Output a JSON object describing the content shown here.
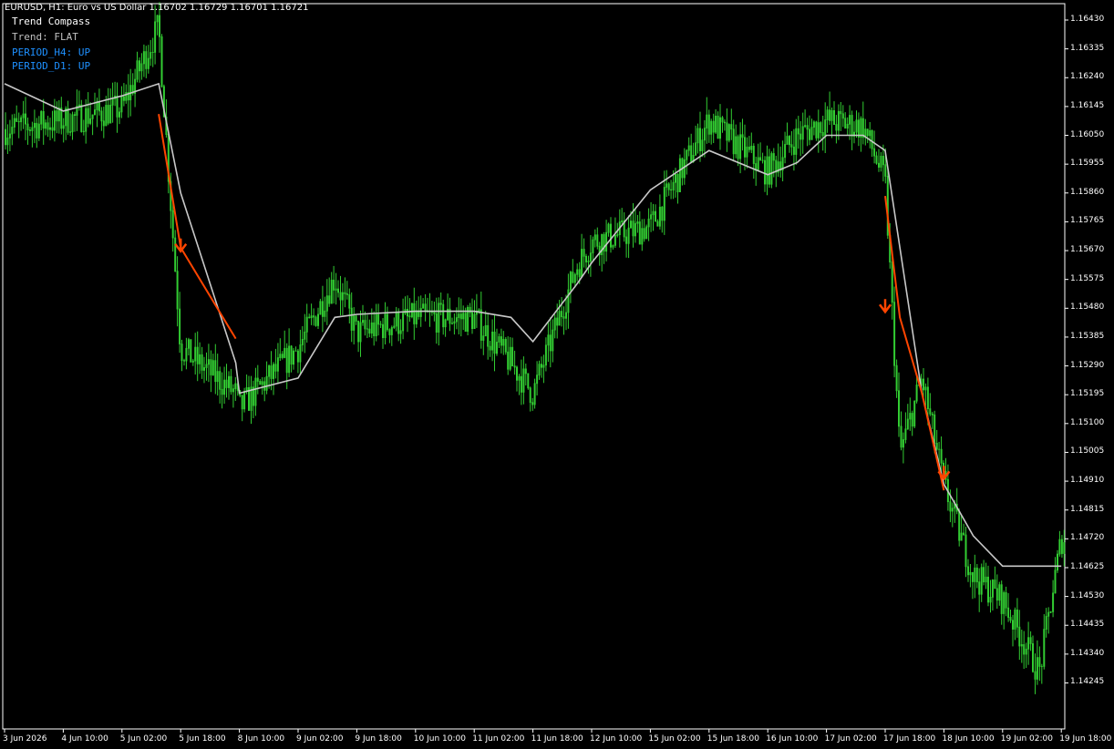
{
  "header": {
    "symbol_line": "EURUSD, H1:  Euro vs US Dollar  1.16702 1.16729 1.16701 1.16721"
  },
  "indicator": {
    "title": "Trend Compass",
    "trend": "Trend: FLAT",
    "h4": "PERIOD_H4: UP",
    "d1": "PERIOD_D1: UP"
  },
  "colors": {
    "background": "#000000",
    "candles": "#32cd32",
    "ma_line": "#c8c8c8",
    "trend_line_down": "#ff4500",
    "arrow": "#ff4500",
    "text": "#ffffff",
    "indicator_blue": "#1e90ff"
  },
  "chart_data": {
    "type": "line",
    "symbol": "EURUSD",
    "timeframe": "H1",
    "y_tick_labels": [
      "1.16430",
      "1.16335",
      "1.16240",
      "1.16145",
      "1.16050",
      "1.15955",
      "1.15860",
      "1.15765",
      "1.15670",
      "1.15575",
      "1.15480",
      "1.15385",
      "1.15290",
      "1.15195",
      "1.15100",
      "1.15005",
      "1.14910",
      "1.14815",
      "1.14720",
      "1.14625",
      "1.14530",
      "1.14435",
      "1.14340",
      "1.14245"
    ],
    "ylim": [
      1.1421,
      1.1649
    ],
    "x_tick_labels": [
      "3 Jun 2026",
      "4 Jun 10:00",
      "5 Jun 02:00",
      "5 Jun 18:00",
      "8 Jun 10:00",
      "9 Jun 02:00",
      "9 Jun 18:00",
      "10 Jun 10:00",
      "11 Jun 02:00",
      "11 Jun 18:00",
      "12 Jun 10:00",
      "15 Jun 02:00",
      "15 Jun 18:00",
      "16 Jun 10:00",
      "17 Jun 02:00",
      "17 Jun 18:00",
      "18 Jun 10:00",
      "19 Jun 02:00",
      "19 Jun 18:00"
    ],
    "price_anchors": {
      "x": [
        "3 Jun 2026",
        "4 Jun 10:00",
        "5 Jun 02:00",
        "5 Jun 12:00",
        "5 Jun 18:00",
        "8 Jun 06:00",
        "8 Jun 10:00",
        "9 Jun 02:00",
        "9 Jun 12:00",
        "9 Jun 18:00",
        "10 Jun 10:00",
        "11 Jun 02:00",
        "11 Jun 12:00",
        "11 Jun 18:00",
        "12 Jun 06:00",
        "12 Jun 10:00",
        "15 Jun 02:00",
        "15 Jun 18:00",
        "16 Jun 10:00",
        "16 Jun 18:00",
        "17 Jun 02:00",
        "17 Jun 12:00",
        "17 Jun 18:00",
        "17 Jun 22:00",
        "18 Jun 04:00",
        "18 Jun 10:00",
        "18 Jun 18:00",
        "19 Jun 02:00",
        "19 Jun 12:00",
        "19 Jun 18:00"
      ],
      "values": [
        1.1607,
        1.161,
        1.1614,
        1.1641,
        1.1535,
        1.152,
        1.1515,
        1.1535,
        1.1558,
        1.154,
        1.1545,
        1.1545,
        1.153,
        1.152,
        1.1562,
        1.157,
        1.1575,
        1.161,
        1.1593,
        1.1605,
        1.161,
        1.1608,
        1.159,
        1.15,
        1.1525,
        1.149,
        1.146,
        1.1452,
        1.1428,
        1.1472
      ]
    },
    "series": [
      {
        "kind": "moving_average",
        "x": [
          "3 Jun 2026",
          "4 Jun 10:00",
          "5 Jun 02:00",
          "5 Jun 12:00",
          "5 Jun 18:00",
          "8 Jun 06:00",
          "8 Jun 10:00",
          "9 Jun 02:00",
          "9 Jun 12:00",
          "9 Jun 18:00",
          "10 Jun 10:00",
          "11 Jun 02:00",
          "11 Jun 12:00",
          "11 Jun 18:00",
          "12 Jun 06:00",
          "12 Jun 10:00",
          "15 Jun 02:00",
          "15 Jun 18:00",
          "16 Jun 10:00",
          "16 Jun 18:00",
          "17 Jun 02:00",
          "17 Jun 12:00",
          "17 Jun 18:00",
          "18 Jun 04:00",
          "18 Jun 10:00",
          "18 Jun 18:00",
          "19 Jun 02:00",
          "19 Jun 18:00"
        ],
        "values": [
          1.1622,
          1.1613,
          1.1618,
          1.1622,
          1.1586,
          1.153,
          1.152,
          1.1525,
          1.1545,
          1.1546,
          1.1547,
          1.1547,
          1.1545,
          1.1537,
          1.1556,
          1.1563,
          1.1587,
          1.16,
          1.1592,
          1.1596,
          1.1605,
          1.1605,
          1.16,
          1.152,
          1.149,
          1.1473,
          1.1463,
          1.1463
        ]
      },
      {
        "kind": "trend_down_segment",
        "x": [
          "5 Jun 12:00",
          "5 Jun 18:00",
          "8 Jun 06:00"
        ],
        "values": [
          1.1612,
          1.1568,
          1.1538
        ]
      },
      {
        "kind": "trend_down_segment",
        "x": [
          "17 Jun 18:00",
          "17 Jun 22:00",
          "18 Jun 04:00",
          "18 Jun 10:00"
        ],
        "values": [
          1.1585,
          1.1545,
          1.152,
          1.1488
        ]
      }
    ],
    "arrows": [
      {
        "direction": "down",
        "x": "5 Jun 18:00",
        "value": 1.1568
      },
      {
        "direction": "down",
        "x": "17 Jun 18:00",
        "value": 1.1548
      },
      {
        "direction": "down",
        "x": "18 Jun 10:00",
        "value": 1.1493
      }
    ],
    "grid": false
  }
}
